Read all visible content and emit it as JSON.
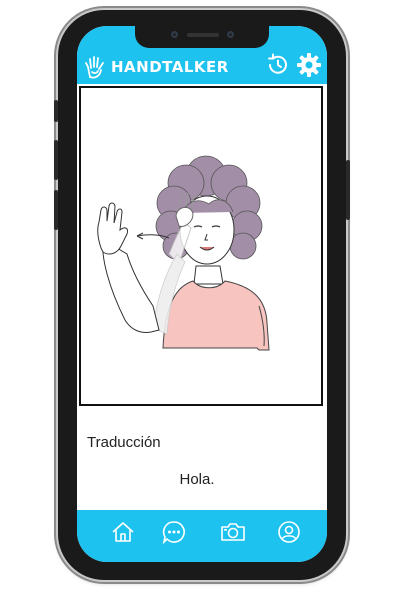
{
  "header": {
    "app_name": "HANDTALKER",
    "icons": [
      "hand-logo-icon",
      "history-icon",
      "gear-icon"
    ]
  },
  "main": {
    "image_alt": "sign-language-hello-illustration",
    "translation_label": "Traducción",
    "translation_text": "Hola."
  },
  "bottom_nav": {
    "items": [
      "home-icon",
      "chat-icon",
      "camera-icon",
      "profile-icon"
    ]
  },
  "colors": {
    "accent": "#1ec2ef",
    "hair": "#a38ea8",
    "shirt": "#f7c4c0",
    "skin": "#ffffff"
  }
}
